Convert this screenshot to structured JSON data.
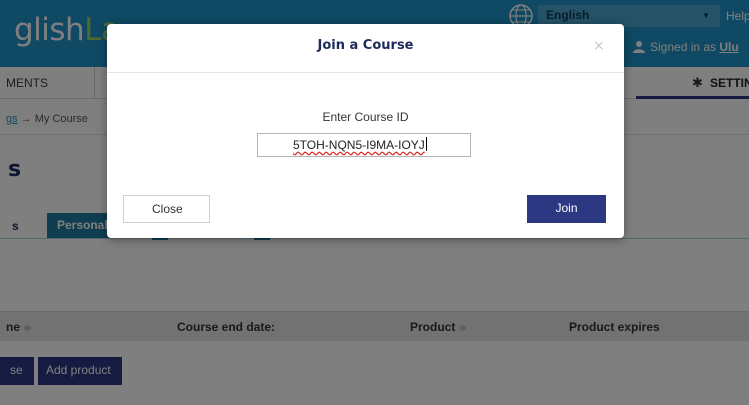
{
  "header": {
    "logo_main": "glish",
    "logo_accent": "La",
    "language": "English",
    "help": "Help",
    "signed_in_prefix": "Signed in as ",
    "signed_in_user": "Ulu"
  },
  "nav": {
    "assignments": "MENTS",
    "settings": "SETTIN"
  },
  "breadcrumb": {
    "link": "gs",
    "separator": "→",
    "current": "My Course"
  },
  "page": {
    "title": "s"
  },
  "tabs": {
    "first": "s",
    "personal": "Personal"
  },
  "table": {
    "columns": [
      {
        "label": "ne",
        "sort": "≑"
      },
      {
        "label": "Course end date:",
        "sort": ""
      },
      {
        "label": "Product",
        "sort": "≑"
      },
      {
        "label": "Product expires",
        "sort": ""
      }
    ]
  },
  "actions": {
    "add_course": "se",
    "add_product": "Add product"
  },
  "modal": {
    "title": "Join a Course",
    "close_x": "×",
    "label": "Enter Course ID",
    "course_id_value": "5TOH-NQN5-I9MA-IOYJ",
    "close_button": "Close",
    "join_button": "Join"
  },
  "colors": {
    "header_bg": "#1e93c6",
    "primary": "#2c3982",
    "tab_active": "#1f7ca0",
    "logo_accent": "#9fd26a"
  }
}
